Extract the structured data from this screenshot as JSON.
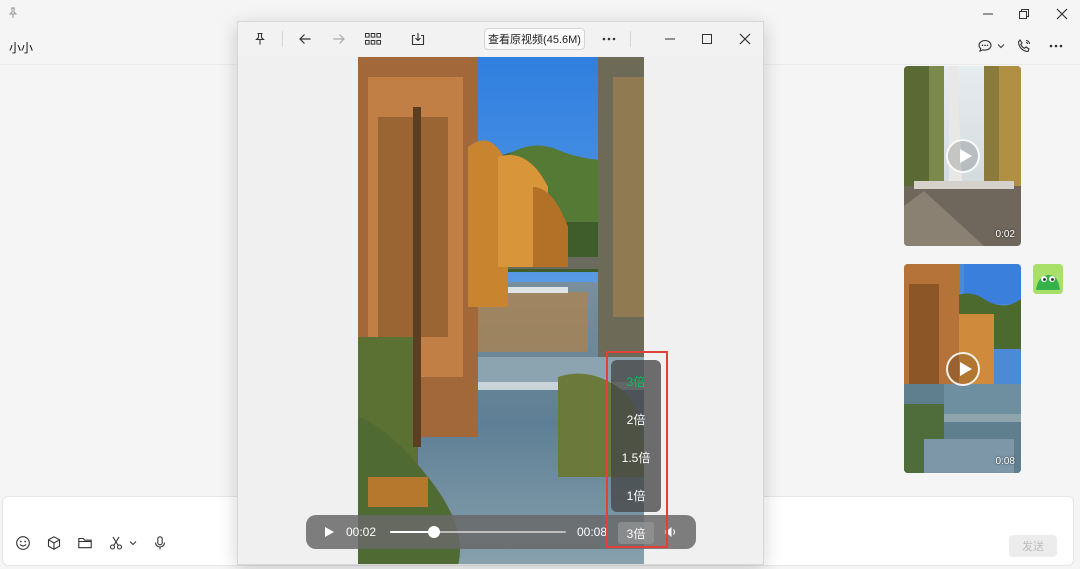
{
  "chat": {
    "title": "小小",
    "messages": [
      {
        "duration": "0:02"
      },
      {
        "duration": "0:08"
      }
    ],
    "send_label": "发送"
  },
  "viewer": {
    "view_original_label": "查看原视频(45.6M)",
    "player": {
      "current_time": "00:02",
      "duration": "00:08",
      "progress": 0.25,
      "speed_label": "3倍"
    },
    "speed_options": [
      {
        "label": "3倍",
        "selected": true
      },
      {
        "label": "2倍",
        "selected": false
      },
      {
        "label": "1.5倍",
        "selected": false
      },
      {
        "label": "1倍",
        "selected": false
      }
    ]
  },
  "colors": {
    "accent_green": "#07c160",
    "highlight_red": "#e0413b"
  },
  "icons": {
    "title_bar": [
      "pin-icon",
      "minimize-icon",
      "maximize-icon",
      "close-icon"
    ],
    "chat_header": [
      "chat-bubble-icon",
      "chevron-down-icon",
      "voice-call-icon",
      "more-icon"
    ],
    "viewer_toolbar": [
      "pin-icon",
      "arrow-left-icon",
      "arrow-right-icon",
      "grid-icon",
      "download-icon",
      "more-icon",
      "minimize-icon",
      "maximize-icon",
      "close-icon"
    ],
    "compose_toolbar": [
      "emoji-icon",
      "cube-icon",
      "folder-icon",
      "scissors-icon",
      "chevron-down-icon",
      "microphone-icon"
    ],
    "player": [
      "play-icon",
      "volume-icon"
    ]
  }
}
